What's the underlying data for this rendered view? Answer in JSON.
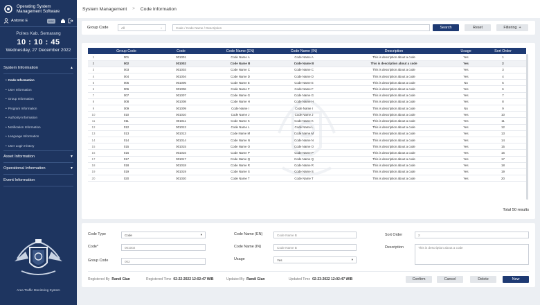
{
  "sidebar": {
    "app_title_line1": "Operating System",
    "app_title_line2": "Management Software",
    "user_name": "Antonio E",
    "badge": "KKK",
    "location": "Polres Kab. Semarang",
    "time": "10 : 10 : 45",
    "date": "Wednesday, 27 December 2022",
    "sections": [
      {
        "label": "System Information",
        "expanded": true
      },
      {
        "label": "Asset Information",
        "expanded": false
      },
      {
        "label": "Operational Information",
        "expanded": false
      },
      {
        "label": "Event Information",
        "expanded": false
      }
    ],
    "system_items": [
      "Code Information",
      "User Information",
      "Group Information",
      "Program Information",
      "Authority Information",
      "Notification Information",
      "Language Information",
      "User Login History"
    ],
    "logo_caption": "Area Traffic Monitoring System"
  },
  "breadcrumb": {
    "root": "System Management",
    "current": "Code Information"
  },
  "filter": {
    "group_code_label": "Group Code",
    "group_code_value": "All",
    "search_placeholder": "Code / Code Name / Description",
    "search_button": "Search",
    "reset_button": "Reset",
    "filtering_button": "Filtering"
  },
  "table": {
    "headers": [
      "",
      "Group Code",
      "Code",
      "Code Name (EN)",
      "Code Name (IN)",
      "Description",
      "Usage",
      "Sort Order"
    ],
    "rows": [
      [
        "1",
        "001",
        "001001",
        "Code Name A",
        "Code Name A",
        "This is description about a code",
        "Yes",
        "1"
      ],
      [
        "2",
        "002",
        "001002",
        "Code Name B",
        "Code Name B",
        "This is description about a code",
        "Yes",
        "2"
      ],
      [
        "3",
        "003",
        "001003",
        "Code Name C",
        "Code Name C",
        "This is description about a code",
        "Yes",
        "3"
      ],
      [
        "4",
        "004",
        "001004",
        "Code Name D",
        "Code Name D",
        "This is description about a code",
        "Yes",
        "4"
      ],
      [
        "5",
        "005",
        "001005",
        "Code Name E",
        "Code Name E",
        "This is description about a code",
        "No",
        "5"
      ],
      [
        "6",
        "006",
        "001006",
        "Code Name F",
        "Code Name F",
        "This is description about a code",
        "Yes",
        "6"
      ],
      [
        "7",
        "007",
        "001007",
        "Code Name G",
        "Code Name G",
        "This is description about a code",
        "Yes",
        "7"
      ],
      [
        "8",
        "008",
        "001008",
        "Code Name H",
        "Code Name H",
        "This is description about a code",
        "Yes",
        "8"
      ],
      [
        "9",
        "009",
        "001009",
        "Code Name I",
        "Code Name I",
        "This is description about a code",
        "No",
        "9"
      ],
      [
        "10",
        "010",
        "001010",
        "Code Name J",
        "Code Name J",
        "This is description about a code",
        "Yes",
        "10"
      ],
      [
        "11",
        "011",
        "001011",
        "Code Name K",
        "Code Name K",
        "This is description about a code",
        "Yes",
        "11"
      ],
      [
        "12",
        "012",
        "001012",
        "Code Name L",
        "Code Name L",
        "This is description about a code",
        "Yes",
        "12"
      ],
      [
        "13",
        "013",
        "001013",
        "Code Name M",
        "Code Name M",
        "This is description about a code",
        "Yes",
        "13"
      ],
      [
        "14",
        "014",
        "001014",
        "Code Name N",
        "Code Name N",
        "This is description about a code",
        "Yes",
        "14"
      ],
      [
        "15",
        "015",
        "001015",
        "Code Name O",
        "Code Name O",
        "This is description about a code",
        "Yes",
        "15"
      ],
      [
        "16",
        "016",
        "001016",
        "Code Name P",
        "Code Name P",
        "This is description about a code",
        "Yes",
        "16"
      ],
      [
        "17",
        "017",
        "001017",
        "Code Name Q",
        "Code Name Q",
        "This is description about a code",
        "Yes",
        "17"
      ],
      [
        "18",
        "018",
        "001018",
        "Code Name R",
        "Code Name R",
        "This is description about a code",
        "Yes",
        "18"
      ],
      [
        "19",
        "019",
        "001019",
        "Code Name S",
        "Code Name S",
        "This is description about a code",
        "Yes",
        "19"
      ],
      [
        "20",
        "020",
        "001020",
        "Code Name T",
        "Code Name T",
        "This is description about a code",
        "Yes",
        "20"
      ]
    ],
    "selected_row": 1,
    "total_text": "Total 50 results"
  },
  "detail": {
    "code_type_label": "Code Type",
    "code_type_value": "Code",
    "code_label": "Code*",
    "code_value": "001002",
    "group_code_label": "Group Code",
    "group_code_value": "002",
    "name_en_label": "Code Name (EN)",
    "name_en_value": "Code Name B",
    "name_in_label": "Code Name (IN)",
    "name_in_value": "Code Name B",
    "usage_label": "Usage",
    "usage_value": "Yes",
    "sort_label": "Sort Order",
    "sort_value": "2",
    "desc_label": "Description",
    "desc_value": "This is description about a code",
    "registered_by_label": "Registered By",
    "registered_by": "Randi Gian",
    "registered_time_label": "Registered Time",
    "registered_time": "02-22-2022 12:02:47 WIB",
    "updated_by_label": "Updated By",
    "updated_by": "Randi Gian",
    "updated_time_label": "Updated Time",
    "updated_time": "02-23-2022 12:02:47 WIB",
    "confirm": "Confirm",
    "cancel": "Cancel",
    "delete": "Delete",
    "new": "New"
  },
  "colors": {
    "sidebar": "#1e3560",
    "accent": "#1e3a73"
  }
}
